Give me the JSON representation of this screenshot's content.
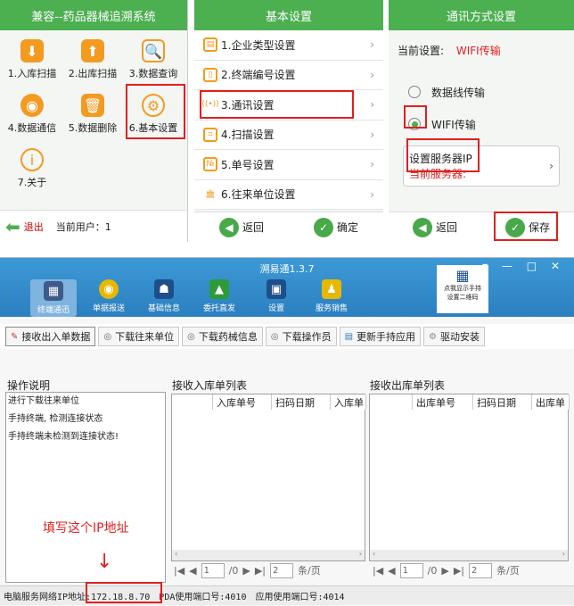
{
  "p1": {
    "title": "兼容--药品器械追溯系统",
    "items": [
      "1.入库扫描",
      "2.出库扫描",
      "3.数据查询",
      "4.数据通信",
      "5.数据删除",
      "6.基本设置",
      "7.关于"
    ],
    "exit": "退出",
    "user": "当前用户：1"
  },
  "p2": {
    "title": "基本设置",
    "items": [
      "1.企业类型设置",
      "2.终端编号设置",
      "3.通讯设置",
      "4.扫描设置",
      "5.单号设置",
      "6.往来单位设置"
    ],
    "back": "返回",
    "ok": "确定"
  },
  "p3": {
    "title": "通讯方式设置",
    "current_label": "当前设置:",
    "current_value": "WIFI传输",
    "opt1": "数据线传输",
    "opt2": "WIFI传输",
    "server_title": "设置服务器IP",
    "server_current": "当前服务器:",
    "back": "返回",
    "save": "保存"
  },
  "app": {
    "title": "溯易通1.3.7",
    "tools": [
      "终端通迅",
      "单据报送",
      "基础信息",
      "委托直发",
      "设置",
      "服务销售"
    ],
    "qr_text1": "点我显示手持",
    "qr_text2": "设置二维码",
    "actions": [
      "接收出入单数据",
      "下载往来单位",
      "下载药械信息",
      "下载操作员",
      "更新手持应用",
      "驱动安装"
    ],
    "op_title": "操作说明",
    "op_lines": [
      "进行下载往来单位",
      "手持终端, 检测连接状态",
      "手持终端未检测到连接状态!"
    ],
    "in_title": "接收入库单列表",
    "in_cols": [
      "入库单号",
      "扫码日期",
      "入库单"
    ],
    "out_title": "接收出库单列表",
    "out_cols": [
      "出库单号",
      "扫码日期",
      "出库单"
    ],
    "page_cur": "1",
    "page_total": "/0",
    "page_size": "2",
    "page_unit": "条/页",
    "annotation": "填写这个IP地址",
    "status_ip": "电脑服务网络IP地址:172.18.8.70",
    "status_pda": "PDA使用端口号:4010",
    "status_app": "应用使用端口号:4014"
  },
  "colors": {
    "green": "#4caf50",
    "orange": "#f39a20",
    "red": "#e02020",
    "blue": "#2b7fc0"
  }
}
